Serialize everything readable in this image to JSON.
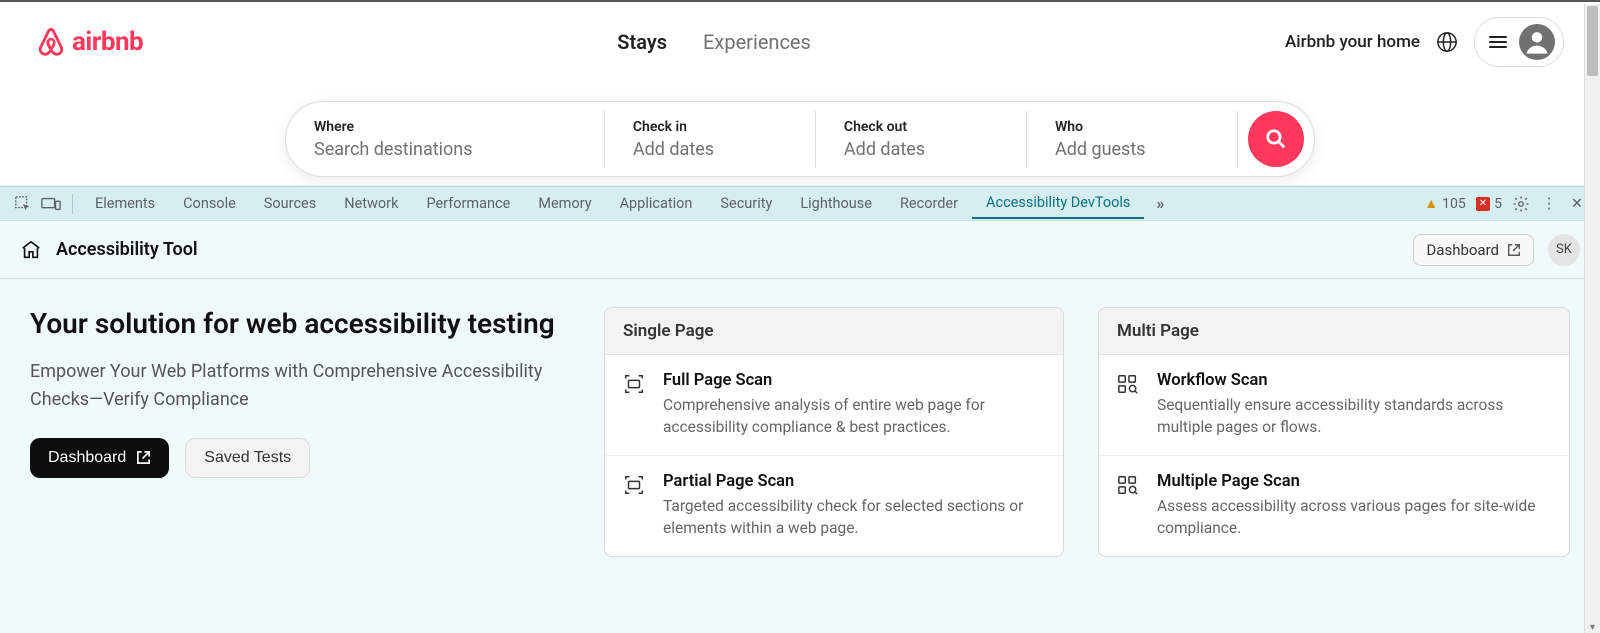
{
  "airbnb": {
    "brand": "airbnb",
    "tabs": {
      "stays": "Stays",
      "experiences": "Experiences"
    },
    "host_link": "Airbnb your home",
    "search": {
      "where": {
        "label": "Where",
        "value": "Search destinations"
      },
      "checkin": {
        "label": "Check in",
        "value": "Add dates"
      },
      "checkout": {
        "label": "Check out",
        "value": "Add dates"
      },
      "who": {
        "label": "Who",
        "value": "Add guests"
      }
    }
  },
  "devtools": {
    "tabs": [
      "Elements",
      "Console",
      "Sources",
      "Network",
      "Performance",
      "Memory",
      "Application",
      "Security",
      "Lighthouse",
      "Recorder",
      "Accessibility DevTools"
    ],
    "active_tab": "Accessibility DevTools",
    "warnings": "105",
    "errors": "5",
    "panel_title": "Accessibility Tool",
    "dashboard_link": "Dashboard",
    "user_initials": "SK",
    "intro": {
      "heading": "Your solution for web accessibility testing",
      "body": "Empower Your Web Platforms with Comprehensive Accessibility\nChecks—Verify Compliance",
      "dashboard_btn": "Dashboard",
      "saved_btn": "Saved Tests"
    },
    "single": {
      "header": "Single Page",
      "items": [
        {
          "title": "Full Page Scan",
          "desc": "Comprehensive analysis of entire web page for accessibility compliance & best practices."
        },
        {
          "title": "Partial Page Scan",
          "desc": "Targeted accessibility check for selected sections or elements within a web page."
        }
      ]
    },
    "multi": {
      "header": "Multi Page",
      "items": [
        {
          "title": "Workflow Scan",
          "desc": "Sequentially ensure accessibility standards across multiple pages or flows."
        },
        {
          "title": "Multiple Page Scan",
          "desc": "Assess accessibility across various pages for site-wide compliance."
        }
      ]
    }
  }
}
